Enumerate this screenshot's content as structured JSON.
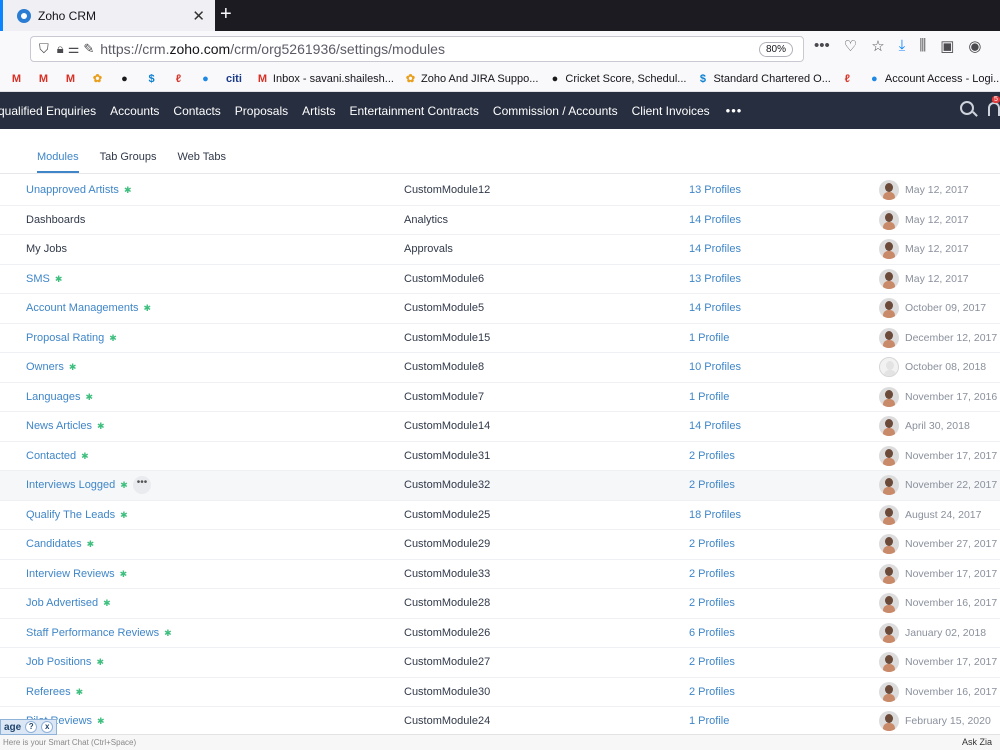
{
  "browser": {
    "tab_title": "Zoho CRM",
    "url_prefix": "https://crm.",
    "url_domain": "zoho.com",
    "url_path": "/crm/org5261936/settings/modules",
    "zoom": "80%"
  },
  "bookmarks": [
    {
      "label": "Inbox - savani.shailesh...",
      "icon": "gmail-icon"
    },
    {
      "label": "Zoho And JIRA Suppo...",
      "icon": "flower-icon"
    },
    {
      "label": "Cricket Score, Schedul...",
      "icon": "cricket-icon"
    },
    {
      "label": "Standard Chartered O...",
      "icon": "bank-icon"
    },
    {
      "label": "Account Access - Logi...",
      "icon": "globe-icon"
    }
  ],
  "crm_nav": {
    "items": [
      "qualified Enquiries",
      "Accounts",
      "Contacts",
      "Proposals",
      "Artists",
      "Entertainment Contracts",
      "Commission / Accounts",
      "Client Invoices"
    ],
    "more": "•••",
    "badge": "5"
  },
  "subtabs": [
    "Modules",
    "Tab Groups",
    "Web Tabs"
  ],
  "modules": [
    {
      "name": "Unapproved Artists",
      "api": "CustomModule12",
      "profiles": "13 Profiles",
      "date": "May 12, 2017",
      "custom": true
    },
    {
      "name": "Dashboards",
      "api": "Analytics",
      "profiles": "14 Profiles",
      "date": "May 12, 2017",
      "custom": false
    },
    {
      "name": "My Jobs",
      "api": "Approvals",
      "profiles": "14 Profiles",
      "date": "May 12, 2017",
      "custom": false
    },
    {
      "name": "SMS",
      "api": "CustomModule6",
      "profiles": "13 Profiles",
      "date": "May 12, 2017",
      "custom": true
    },
    {
      "name": "Account Managements",
      "api": "CustomModule5",
      "profiles": "14 Profiles",
      "date": "October 09, 2017",
      "custom": true
    },
    {
      "name": "Proposal Rating",
      "api": "CustomModule15",
      "profiles": "1 Profile",
      "date": "December 12, 2017",
      "custom": true
    },
    {
      "name": "Owners",
      "api": "CustomModule8",
      "profiles": "10 Profiles",
      "date": "October 08, 2018",
      "custom": true,
      "blank_avatar": true
    },
    {
      "name": "Languages",
      "api": "CustomModule7",
      "profiles": "1 Profile",
      "date": "November 17, 2016",
      "custom": true
    },
    {
      "name": "News Articles",
      "api": "CustomModule14",
      "profiles": "14 Profiles",
      "date": "April 30, 2018",
      "custom": true
    },
    {
      "name": "Contacted",
      "api": "CustomModule31",
      "profiles": "2 Profiles",
      "date": "November 17, 2017",
      "custom": true
    },
    {
      "name": "Interviews Logged",
      "api": "CustomModule32",
      "profiles": "2 Profiles",
      "date": "November 22, 2017",
      "custom": true,
      "hover": true
    },
    {
      "name": "Qualify The Leads",
      "api": "CustomModule25",
      "profiles": "18 Profiles",
      "date": "August 24, 2017",
      "custom": true
    },
    {
      "name": "Candidates",
      "api": "CustomModule29",
      "profiles": "2 Profiles",
      "date": "November 27, 2017",
      "custom": true
    },
    {
      "name": "Interview Reviews",
      "api": "CustomModule33",
      "profiles": "2 Profiles",
      "date": "November 17, 2017",
      "custom": true
    },
    {
      "name": "Job Advertised",
      "api": "CustomModule28",
      "profiles": "2 Profiles",
      "date": "November 16, 2017",
      "custom": true
    },
    {
      "name": "Staff Performance Reviews",
      "api": "CustomModule26",
      "profiles": "6 Profiles",
      "date": "January 02, 2018",
      "custom": true
    },
    {
      "name": "Job Positions",
      "api": "CustomModule27",
      "profiles": "2 Profiles",
      "date": "November 17, 2017",
      "custom": true
    },
    {
      "name": "Referees",
      "api": "CustomModule30",
      "profiles": "2 Profiles",
      "date": "November 16, 2017",
      "custom": true
    },
    {
      "name": "Pilot Reviews",
      "api": "CustomModule24",
      "profiles": "1 Profile",
      "date": "February 15, 2020",
      "custom": true
    }
  ],
  "chat": {
    "hint": "Here is your Smart Chat (Ctrl+Space)",
    "ask": "Ask Zia",
    "pill": "age"
  },
  "colors": {
    "accent": "#3f86c8",
    "nav_bg": "#272e3f",
    "custom_dot": "#3fbf7f"
  }
}
